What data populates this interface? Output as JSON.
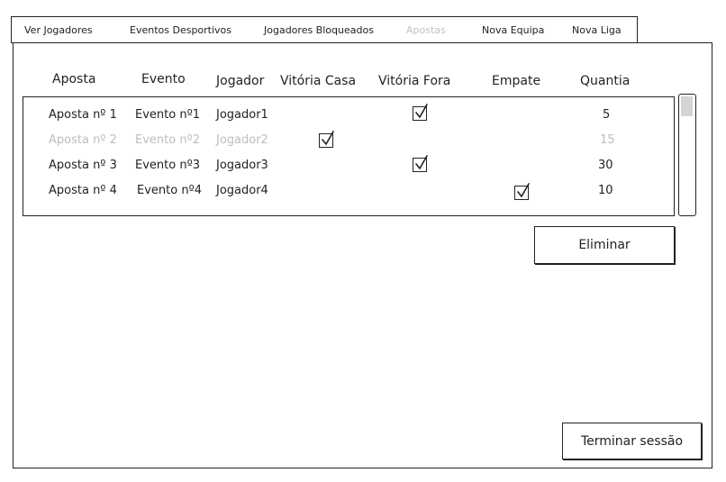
{
  "nav": {
    "items": [
      {
        "label": "Ver Jogadores"
      },
      {
        "label": "Eventos Desportivos"
      },
      {
        "label": "Jogadores Bloqueados"
      },
      {
        "label": "Apostas"
      },
      {
        "label": "Nova Equipa"
      },
      {
        "label": "Nova Liga"
      }
    ],
    "active": "Apostas"
  },
  "table": {
    "headers": [
      "Aposta",
      "Evento",
      "Jogador",
      "Vitória Casa",
      "Vitória Fora",
      "Empate",
      "Quantia"
    ],
    "rows": [
      {
        "aposta": "Aposta nº 1",
        "evento": "Evento nº1",
        "jogador": "Jogador1",
        "checked": "Vitória Fora",
        "quantia": "5",
        "disabled": false
      },
      {
        "aposta": "Aposta nº 2",
        "evento": "Evento nº2",
        "jogador": "Jogador2",
        "checked": "Vitória Casa",
        "quantia": "15",
        "disabled": true
      },
      {
        "aposta": "Aposta nº 3",
        "evento": "Evento nº3",
        "jogador": "Jogador3",
        "checked": "Vitória Fora",
        "quantia": "30",
        "disabled": false
      },
      {
        "aposta": "Aposta nº 4",
        "evento": "Evento nº4",
        "jogador": "Jogador4",
        "checked": "Empate",
        "quantia": "10",
        "disabled": false
      }
    ]
  },
  "buttons": {
    "eliminar": "Eliminar",
    "logout": "Terminar sessão"
  },
  "icons": {
    "checkbox": "checkmark-icon"
  },
  "colors": {
    "line": "#222222",
    "disabled_text": "#bdbdbd",
    "scroll_thumb": "#d4d4d4"
  }
}
